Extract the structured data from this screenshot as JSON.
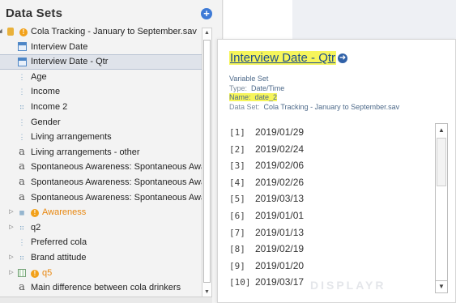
{
  "panel": {
    "title": "Data Sets",
    "add_icon": "plus-circle-icon"
  },
  "tree": [
    {
      "label": "Cola Tracking - January to September.sav",
      "icon": "database-icon",
      "warn": true,
      "expanded": true,
      "indent": 0
    },
    {
      "label": "Interview Date",
      "icon": "date-icon",
      "indent": 1
    },
    {
      "label": "Interview Date - Qtr",
      "icon": "date-icon",
      "indent": 1,
      "selected": true
    },
    {
      "label": "Age",
      "icon": "numeric-icon",
      "indent": 1
    },
    {
      "label": "Income",
      "icon": "numeric-icon",
      "indent": 1
    },
    {
      "label": "Income 2",
      "icon": "numeric-multi-icon",
      "indent": 1
    },
    {
      "label": "Gender",
      "icon": "numeric-icon",
      "indent": 1
    },
    {
      "label": "Living arrangements",
      "icon": "numeric-icon",
      "indent": 1
    },
    {
      "label": "Living arrangements - other",
      "icon": "text-icon",
      "indent": 1
    },
    {
      "label": "Spontaneous Awareness: Spontaneous Awareness",
      "icon": "text-icon",
      "indent": 1
    },
    {
      "label": "Spontaneous Awareness: Spontaneous Awareness",
      "icon": "text-icon",
      "indent": 1
    },
    {
      "label": "Spontaneous Awareness: Spontaneous Awareness",
      "icon": "text-icon",
      "indent": 1
    },
    {
      "label": "Awareness",
      "icon": "numeric-set-icon",
      "warn": true,
      "collapsed": true,
      "orange": true,
      "indent": 1
    },
    {
      "label": "q2",
      "icon": "numeric-multi-icon",
      "collapsed": true,
      "indent": 1
    },
    {
      "label": "Preferred cola",
      "icon": "numeric-icon",
      "indent": 1
    },
    {
      "label": "Brand attitude",
      "icon": "numeric-grid-icon",
      "collapsed": true,
      "indent": 1
    },
    {
      "label": "q5",
      "icon": "grid-icon",
      "warn": true,
      "collapsed": true,
      "orange": true,
      "indent": 1
    },
    {
      "label": "Main difference between cola drinkers",
      "icon": "text-icon",
      "indent": 1
    }
  ],
  "card": {
    "title": "Interview Date - Qtr",
    "type_heading": "Variable Set",
    "type_label": "Type:",
    "type_value": "Date/Time",
    "name_label": "Name:",
    "name_value": "date_2",
    "dataset_label": "Data Set:",
    "dataset_value": "Cola Tracking - January to September.sav",
    "values": [
      {
        "idx": "[1]",
        "val": "2019/01/29"
      },
      {
        "idx": "[2]",
        "val": "2019/02/24"
      },
      {
        "idx": "[3]",
        "val": "2019/02/06"
      },
      {
        "idx": "[4]",
        "val": "2019/02/26"
      },
      {
        "idx": "[5]",
        "val": "2019/03/13"
      },
      {
        "idx": "[6]",
        "val": "2019/01/01"
      },
      {
        "idx": "[7]",
        "val": "2019/01/13"
      },
      {
        "idx": "[8]",
        "val": "2019/02/19"
      },
      {
        "idx": "[9]",
        "val": "2019/01/20"
      },
      {
        "idx": "[10]",
        "val": "2019/03/17"
      }
    ],
    "watermark": "DISPLAYR"
  },
  "colors": {
    "highlight": "#f6f55b",
    "accent": "#3e7ad6",
    "warning": "#e8870f"
  }
}
